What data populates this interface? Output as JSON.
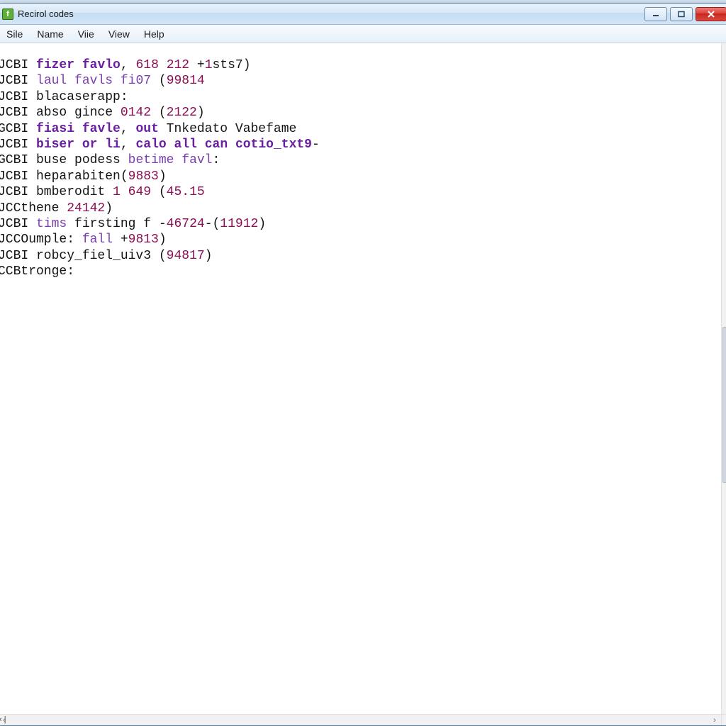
{
  "window": {
    "title": "Recirol codes"
  },
  "menu": {
    "items": [
      "Sile",
      "Name",
      "Viie",
      "View",
      "Help"
    ]
  },
  "code": {
    "lines": [
      {
        "segs": [
          [
            "",
            "JCBI "
          ],
          [
            "kw",
            "fizer"
          ],
          [
            "",
            " "
          ],
          [
            "kw",
            "favlo"
          ],
          [
            "",
            ", "
          ],
          [
            "num",
            "618"
          ],
          [
            "",
            " "
          ],
          [
            "num",
            "212"
          ],
          [
            "",
            " +"
          ],
          [
            "num",
            "1"
          ],
          [
            "",
            "sts7)"
          ]
        ]
      },
      {
        "segs": [
          [
            "",
            "JCBI "
          ],
          [
            "id",
            "laul"
          ],
          [
            "",
            " "
          ],
          [
            "id",
            "favls"
          ],
          [
            "",
            " "
          ],
          [
            "id",
            "fi07"
          ],
          [
            "",
            " ("
          ],
          [
            "num",
            "99814"
          ]
        ]
      },
      {
        "segs": [
          [
            "",
            "JCBI blacaserapp:"
          ]
        ]
      },
      {
        "segs": [
          [
            "",
            "JCBI abso gince "
          ],
          [
            "num",
            "0142"
          ],
          [
            "",
            " ("
          ],
          [
            "num",
            "2122"
          ],
          [
            "",
            ")"
          ]
        ]
      },
      {
        "segs": [
          [
            "",
            "GCBI "
          ],
          [
            "kw",
            "fiasi"
          ],
          [
            "",
            " "
          ],
          [
            "kw",
            "favle"
          ],
          [
            "",
            ", "
          ],
          [
            "kw",
            "out"
          ],
          [
            "",
            " Tnkedato Vabefame"
          ]
        ]
      },
      {
        "segs": [
          [
            "",
            "JCBI "
          ],
          [
            "kw",
            "biser"
          ],
          [
            "",
            " "
          ],
          [
            "kw",
            "or"
          ],
          [
            "",
            " "
          ],
          [
            "kw",
            "li"
          ],
          [
            "",
            ", "
          ],
          [
            "kw",
            "calo"
          ],
          [
            "",
            " "
          ],
          [
            "kw",
            "all"
          ],
          [
            "",
            " "
          ],
          [
            "kw",
            "can"
          ],
          [
            "",
            " "
          ],
          [
            "kw",
            "cotio_txt9"
          ],
          [
            "",
            "-"
          ]
        ]
      },
      {
        "segs": [
          [
            "",
            "GCBI buse podess "
          ],
          [
            "id",
            "betime"
          ],
          [
            "",
            " "
          ],
          [
            "id",
            "favl"
          ],
          [
            "",
            ":"
          ]
        ]
      },
      {
        "segs": [
          [
            "",
            "JCBI heparabiten("
          ],
          [
            "num",
            "9883"
          ],
          [
            "",
            ")"
          ]
        ]
      },
      {
        "segs": [
          [
            "",
            "JCBI bmberodit "
          ],
          [
            "num",
            "1"
          ],
          [
            "",
            " "
          ],
          [
            "num",
            "649"
          ],
          [
            "",
            " ("
          ],
          [
            "num",
            "45.15"
          ]
        ]
      },
      {
        "segs": [
          [
            "",
            "JCCthene "
          ],
          [
            "num",
            "24142"
          ],
          [
            "",
            ")"
          ]
        ]
      },
      {
        "segs": [
          [
            "",
            "JCBI "
          ],
          [
            "id",
            "tims"
          ],
          [
            "",
            " firsting f -"
          ],
          [
            "num",
            "46724"
          ],
          [
            "",
            "-("
          ],
          [
            "num",
            "11912"
          ],
          [
            "",
            ")"
          ]
        ]
      },
      {
        "segs": [
          [
            "",
            "JCCOumple: "
          ],
          [
            "id",
            "fall"
          ],
          [
            "",
            " +"
          ],
          [
            "num",
            "9813"
          ],
          [
            "",
            ")"
          ]
        ]
      },
      {
        "segs": [
          [
            "",
            "JCBI robcy_fiel_uiv3 ("
          ],
          [
            "num",
            "94817"
          ],
          [
            "",
            ")"
          ]
        ]
      },
      {
        "segs": [
          [
            "",
            "CCBtronge:"
          ]
        ]
      }
    ]
  },
  "status": {
    "left": "‹ |"
  }
}
